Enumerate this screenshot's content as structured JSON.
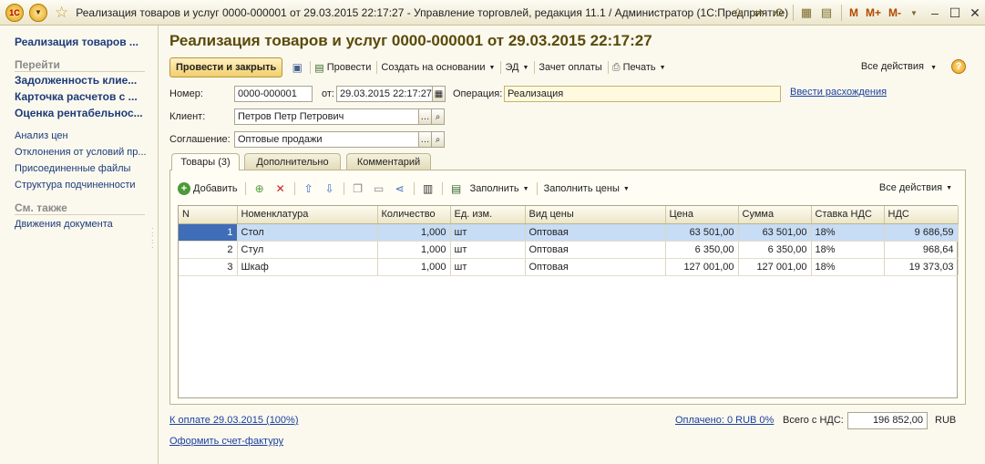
{
  "window": {
    "title": "Реализация товаров и услуг 0000-000001 от 29.03.2015 22:17:27 - Управление торговлей, редакция 11.1 / Администратор  (1С:Предприятие)",
    "logo_text": "1С",
    "mem_buttons": [
      "M",
      "M+",
      "M-"
    ]
  },
  "left_panel": {
    "current": "Реализация товаров ...",
    "goto_header": "Перейти",
    "goto_items": [
      "Задолженность клие...",
      "Карточка расчетов с ...",
      "Оценка рентабельнос..."
    ],
    "links": [
      "Анализ цен",
      "Отклонения от условий пр...",
      "Присоединенные файлы",
      "Структура подчиненности"
    ],
    "see_also_header": "См. также",
    "see_also_items": [
      "Движения документа"
    ]
  },
  "form": {
    "title": "Реализация товаров и услуг 0000-000001 от 29.03.2015 22:17:27",
    "commands": {
      "post_and_close": "Провести и закрыть",
      "post": "Провести",
      "create_based_on": "Создать на основании",
      "ed": "ЭД",
      "payment_offset": "Зачет оплаты",
      "print": "Печать",
      "all_actions": "Все действия",
      "help": "?"
    },
    "fields": {
      "number_label": "Номер:",
      "number_value": "0000-000001",
      "date_label": "от:",
      "date_value": "29.03.2015 22:17:27",
      "operation_label": "Операция:",
      "operation_value": "Реализация",
      "discrepancy_link": "Ввести расхождения",
      "client_label": "Клиент:",
      "client_value": "Петров Петр Петрович",
      "agreement_label": "Соглашение:",
      "agreement_value": "Оптовые продажи"
    },
    "tabs": [
      "Товары (3)",
      "Дополнительно",
      "Комментарий"
    ],
    "goods_bar": {
      "add": "Добавить",
      "fill": "Заполнить",
      "fill_prices": "Заполнить цены",
      "all_actions": "Все действия"
    },
    "table": {
      "columns": [
        "N",
        "Номенклатура",
        "Количество",
        "Ед. изм.",
        "Вид цены",
        "Цена",
        "Сумма",
        "Ставка НДС",
        "НДС"
      ],
      "rows": [
        [
          "1",
          "Стол",
          "1,000",
          "шт",
          "Оптовая",
          "63 501,00",
          "63 501,00",
          "18%",
          "9 686,59"
        ],
        [
          "2",
          "Стул",
          "1,000",
          "шт",
          "Оптовая",
          "6 350,00",
          "6 350,00",
          "18%",
          "968,64"
        ],
        [
          "3",
          "Шкаф",
          "1,000",
          "шт",
          "Оптовая",
          "127 001,00",
          "127 001,00",
          "18%",
          "19 373,03"
        ]
      ]
    },
    "footer": {
      "payment_link": "К оплате 29.03.2015 (100%)",
      "paid_link": "Оплачено: 0 RUB  0%",
      "total_label": "Всего с НДС:",
      "total_value": "196 852,00",
      "currency": "RUB",
      "invoice_link": "Оформить счет-фактуру"
    }
  }
}
